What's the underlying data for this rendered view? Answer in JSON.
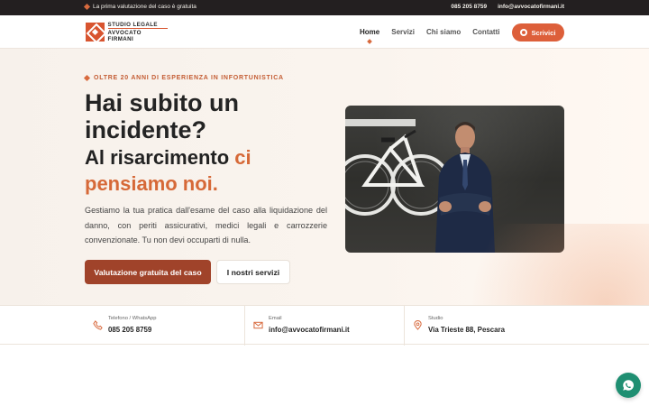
{
  "topbar": {
    "promo_text": "La prima valutazione del caso è gratuita",
    "phone": "085 205 8759",
    "email": "info@avvocatofirmani.it"
  },
  "logo": {
    "line1": "STUDIO LEGALE",
    "line2": "AVVOCATO FIRMANI"
  },
  "nav": {
    "items": [
      {
        "label": "Home",
        "active": true
      },
      {
        "label": "Servizi",
        "active": false
      },
      {
        "label": "Chi siamo",
        "active": false
      },
      {
        "label": "Contatti",
        "active": false
      }
    ],
    "cta_label": "Scrivici"
  },
  "hero": {
    "tagline": "OLTRE 20 ANNI DI ESPERIENZA IN INFORTUNISTICA",
    "headline": "Hai subito un incidente?",
    "subheadline_start": "Al risarcimento ",
    "subheadline_accent": "ci pensiamo noi.",
    "description": "Gestiamo la tua pratica dall'esame del caso alla liquidazione del danno, con periti assicurativi, medici legali e carrozzerie convenzionate. Tu non devi occuparti di nulla.",
    "primary_button": "Valutazione gratuita del caso",
    "secondary_button": "I nostri servizi"
  },
  "contact_bar": {
    "items": [
      {
        "label": "Telefono / WhatsApp",
        "value": "085 205 8759",
        "icon": "phone-icon"
      },
      {
        "label": "Email",
        "value": "info@avvocatofirmani.it",
        "icon": "mail-icon"
      },
      {
        "label": "Studio",
        "value": "Via Trieste 88, Pescara",
        "icon": "location-icon"
      }
    ]
  },
  "colors": {
    "accent": "#d86a3e",
    "primary_button": "#a0432a",
    "topbar_bg": "#231f20",
    "whatsapp": "#1f8f72"
  }
}
